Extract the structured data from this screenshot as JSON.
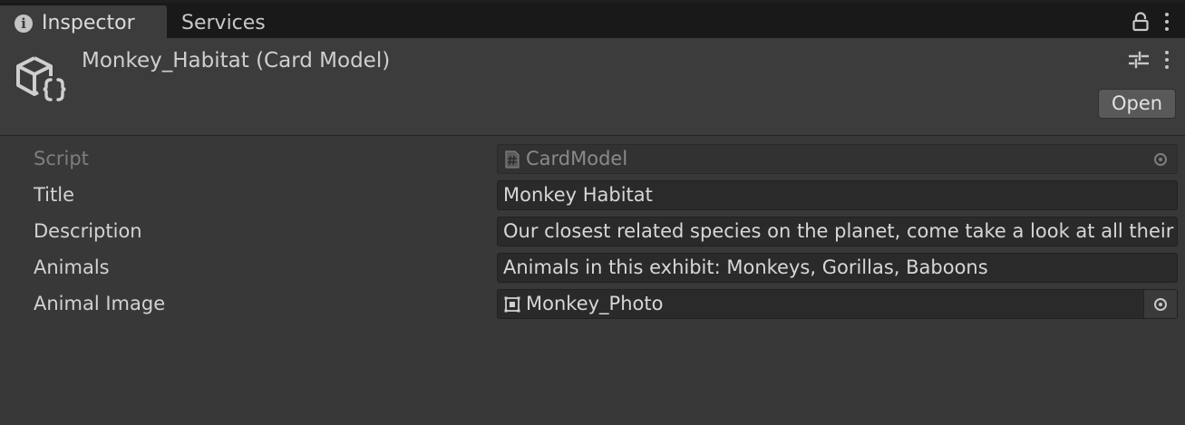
{
  "tabs": [
    {
      "label": "Inspector",
      "icon": "info-icon",
      "active": true
    },
    {
      "label": "Services",
      "active": false
    }
  ],
  "tab_actions": {
    "lock_icon": "lock-icon",
    "menu_icon": "kebab-menu-icon"
  },
  "header": {
    "title": "Monkey_Habitat (Card Model)",
    "icon": "scriptable-object-icon",
    "open_label": "Open",
    "settings_icon": "sliders-icon",
    "menu_icon": "kebab-menu-icon"
  },
  "properties": [
    {
      "label": "Script",
      "value": "CardModel",
      "kind": "object",
      "icon": "script-hash-icon",
      "disabled": true
    },
    {
      "label": "Title",
      "value": "Monkey Habitat",
      "kind": "text"
    },
    {
      "label": "Description",
      "value": "Our closest related species on the planet, come take a look at all their antics",
      "kind": "text"
    },
    {
      "label": "Animals",
      "value": "Animals in this exhibit: Monkeys, Gorillas, Baboons",
      "kind": "text"
    },
    {
      "label": "Animal Image",
      "value": "Monkey_Photo",
      "kind": "object",
      "icon": "sprite-icon"
    }
  ],
  "colors": {
    "background": "#383838",
    "tabbar": "#191919",
    "field": "#2a2a2a",
    "text": "#d2d2d2",
    "disabled_text": "#7e7e7e"
  }
}
